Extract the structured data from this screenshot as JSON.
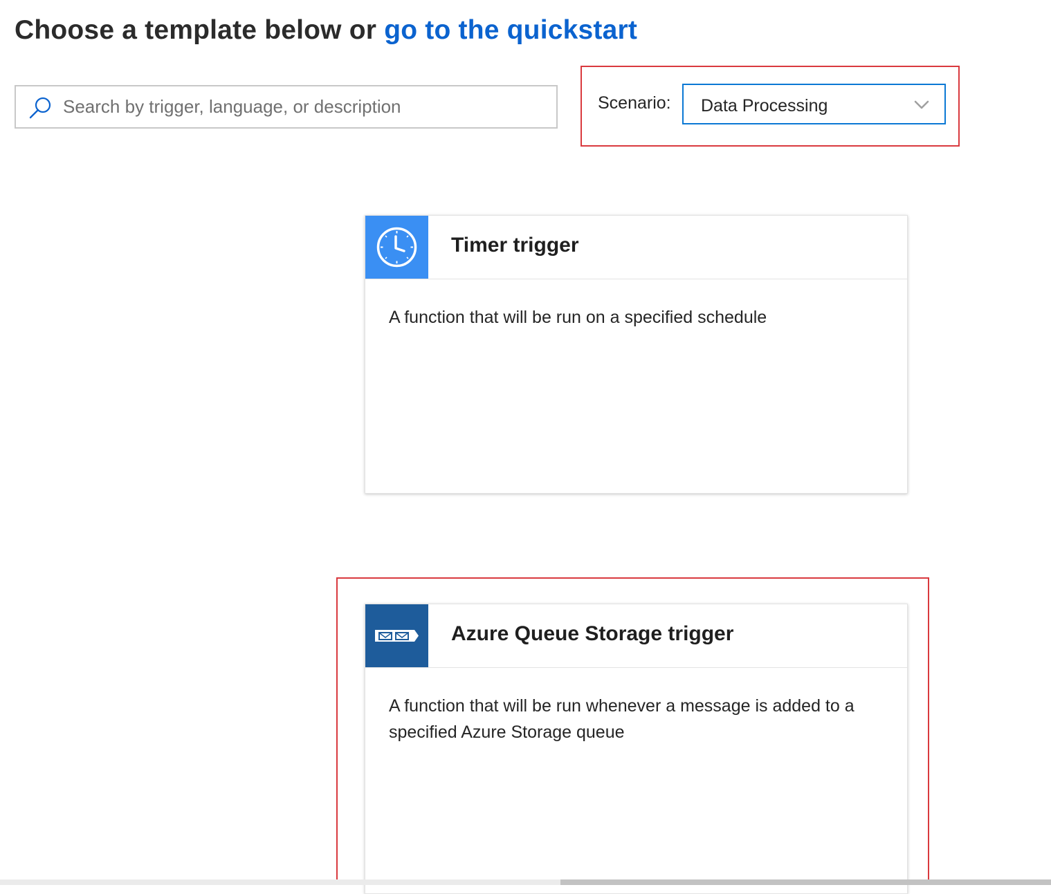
{
  "header": {
    "lead_text": "Choose a template below or",
    "quickstart_link": "go to the quickstart"
  },
  "search": {
    "placeholder": "Search by trigger, language, or description",
    "value": ""
  },
  "scenario": {
    "label": "Scenario:",
    "selected": "Data Processing"
  },
  "templates": [
    {
      "title": "Timer trigger",
      "description": "A function that will be run on a specified schedule",
      "icon": "clock-icon",
      "icon_bg": "#3a8ff3"
    },
    {
      "title": "Azure Queue Storage trigger",
      "description": "A function that will be run whenever a message is added to a specified Azure Storage queue",
      "icon": "queue-message-icon",
      "icon_bg": "#1e5c9b"
    }
  ],
  "colors": {
    "link": "#0b63cf",
    "highlight_border": "#d9393e",
    "focus_border": "#0a78d4"
  }
}
